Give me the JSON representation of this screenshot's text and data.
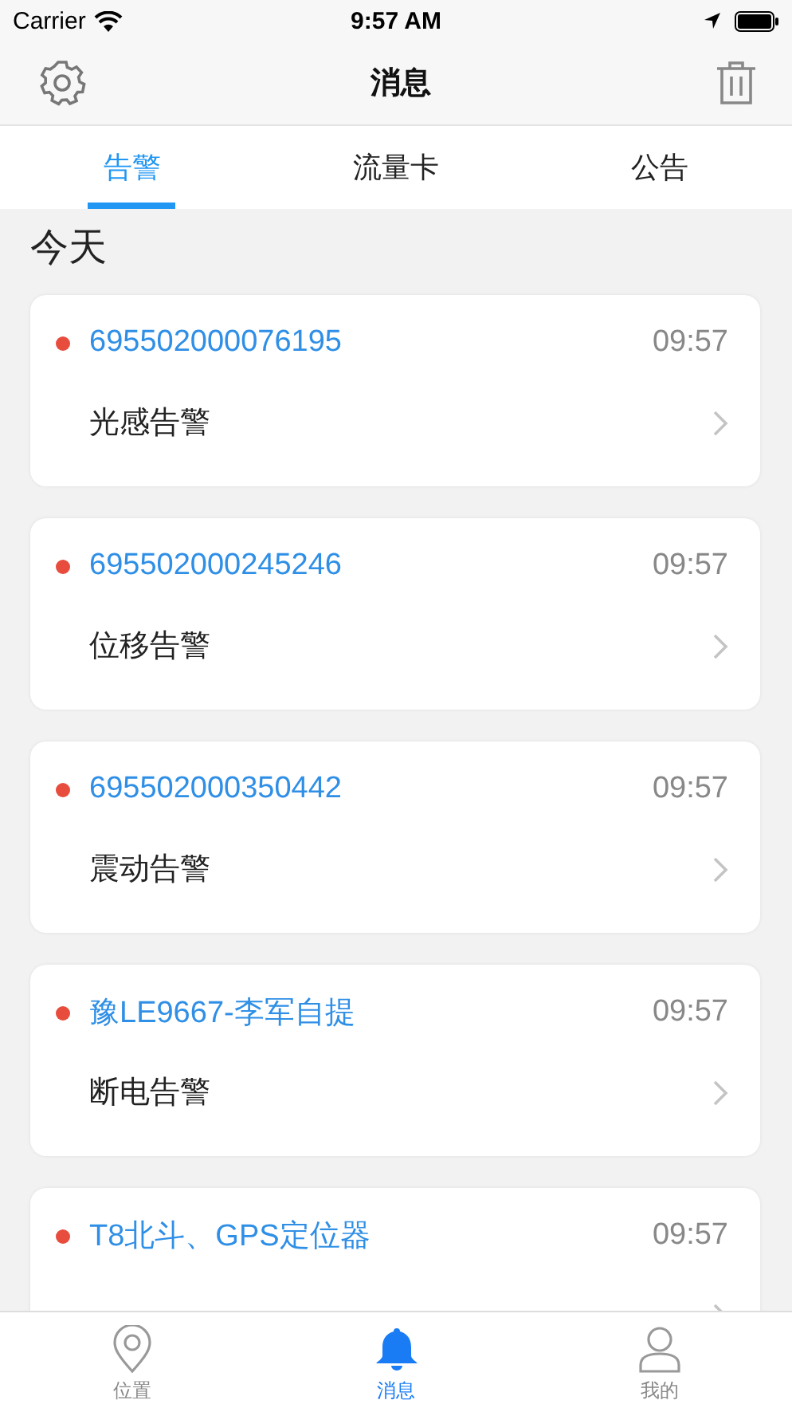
{
  "status_bar": {
    "carrier": "Carrier",
    "time": "9:57 AM"
  },
  "nav": {
    "title": "消息"
  },
  "tabs": [
    {
      "label": "告警",
      "selected": true
    },
    {
      "label": "流量卡",
      "selected": false
    },
    {
      "label": "公告",
      "selected": false
    }
  ],
  "section": "今天",
  "alerts": [
    {
      "device": "695502000076195",
      "time": "09:57",
      "type": "光感告警",
      "unread": true
    },
    {
      "device": "695502000245246",
      "time": "09:57",
      "type": "位移告警",
      "unread": true
    },
    {
      "device": "695502000350442",
      "time": "09:57",
      "type": "震动告警",
      "unread": true
    },
    {
      "device": "豫LE9667-李军自提",
      "time": "09:57",
      "type": "断电告警",
      "unread": true
    },
    {
      "device": "T8北斗、GPS定位器",
      "time": "09:57",
      "unread": true
    }
  ],
  "tab_bar": [
    {
      "label": "位置",
      "kind": "location",
      "selected": false
    },
    {
      "label": "消息",
      "kind": "messages",
      "selected": true
    },
    {
      "label": "我的",
      "kind": "profile",
      "selected": false
    }
  ]
}
